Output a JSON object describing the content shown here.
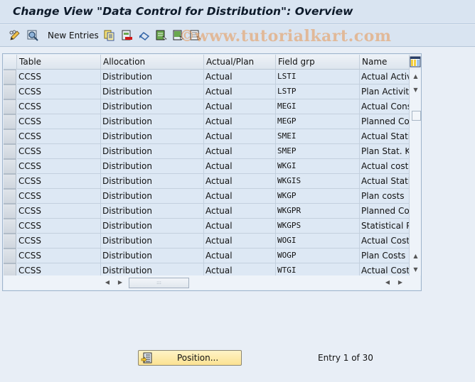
{
  "window": {
    "title": "Change View \"Data Control for Distribution\": Overview"
  },
  "toolbar": {
    "icons": [
      "display-change-icon",
      "details-icon",
      "copy-as-icon",
      "delete-icon",
      "undo-change-icon",
      "select-all-icon",
      "select-block-icon",
      "deselect-all-icon"
    ],
    "new_entries_label": "New Entries"
  },
  "watermark": "©www.tutorialkart.com",
  "table": {
    "columns": [
      "Table",
      "Allocation",
      "Actual/Plan",
      "Field grp",
      "Name"
    ],
    "rows": [
      [
        "CCSS",
        "Distribution",
        "Actual",
        "LSTI",
        "Actual Activi"
      ],
      [
        "CCSS",
        "Distribution",
        "Actual",
        "LSTP",
        "Plan Activity"
      ],
      [
        "CCSS",
        "Distribution",
        "Actual",
        "MEGI",
        "Actual Consu"
      ],
      [
        "CCSS",
        "Distribution",
        "Actual",
        "MEGP",
        "Planned Con"
      ],
      [
        "CCSS",
        "Distribution",
        "Actual",
        "SMEI",
        "Actual Statis"
      ],
      [
        "CCSS",
        "Distribution",
        "Actual",
        "SMEP",
        "Plan Stat. Ke"
      ],
      [
        "CCSS",
        "Distribution",
        "Actual",
        "WKGI",
        "Actual costs"
      ],
      [
        "CCSS",
        "Distribution",
        "Actual",
        "WKGIS",
        "Actual Statis"
      ],
      [
        "CCSS",
        "Distribution",
        "Actual",
        "WKGP",
        "Plan costs"
      ],
      [
        "CCSS",
        "Distribution",
        "Actual",
        "WKGPR",
        "Planned Cos"
      ],
      [
        "CCSS",
        "Distribution",
        "Actual",
        "WKGPS",
        "Statistical Pla"
      ],
      [
        "CCSS",
        "Distribution",
        "Actual",
        "WOGI",
        "Actual Costs"
      ],
      [
        "CCSS",
        "Distribution",
        "Actual",
        "WOGP",
        "Plan Costs ("
      ],
      [
        "CCSS",
        "Distribution",
        "Actual",
        "WTGI",
        "Actual Costs"
      ]
    ]
  },
  "footer": {
    "position_button_label": "Position...",
    "entry_text": "Entry 1 of 30"
  }
}
